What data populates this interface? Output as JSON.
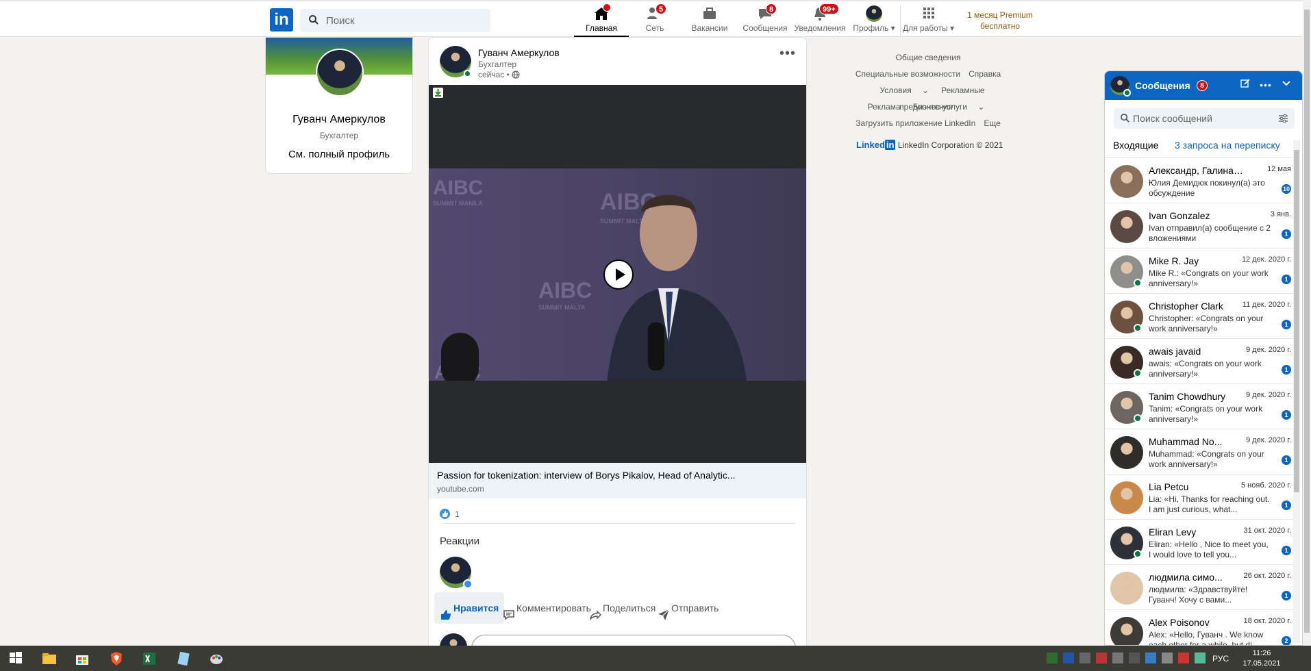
{
  "nav": {
    "search_placeholder": "Поиск",
    "items": [
      {
        "label": "Главная",
        "badge": ""
      },
      {
        "label": "Сеть",
        "badge": "5"
      },
      {
        "label": "Вакансии",
        "badge": ""
      },
      {
        "label": "Сообщения",
        "badge": "8"
      },
      {
        "label": "Уведомления",
        "badge": "99+"
      },
      {
        "label": "Профиль",
        "badge": ""
      },
      {
        "label": "Для работы",
        "badge": ""
      }
    ],
    "premium_line1": "1 месяц Premium",
    "premium_line2": "бесплатно"
  },
  "profile": {
    "name": "Гуванч Амеркулов",
    "title": "Бухгалтер",
    "link": "См. полный профиль"
  },
  "post": {
    "author": "Гуванч Амеркулов",
    "subtitle": "Бухгалтер",
    "time": "сейчас •",
    "link_title": "Passion for tokenization: interview of Borys Pikalov, Head of Analytic...",
    "link_domain": "youtube.com",
    "likes_count": "1",
    "reactions_title": "Реакции",
    "actions": {
      "like": "Нравится",
      "comment": "Комментировать",
      "share": "Поделиться",
      "send": "Отправить"
    },
    "video_watermarks": [
      "AIBC",
      "SUMMIT MANILA",
      "AIBC",
      "SUMMIT MALTA",
      "AIBC",
      "SUMMIT MALTA",
      "AIBC"
    ]
  },
  "footer": {
    "rows": [
      [
        "Общие сведения"
      ],
      [
        "Специальные возможности",
        "Справка"
      ],
      [
        "Условия",
        "Рекламные предпочтения"
      ],
      [
        "Реклама",
        "Бизнес-услуги"
      ],
      [
        "Загрузить приложение LinkedIn",
        "Еще"
      ]
    ],
    "copyright_brand": "Linked",
    "copyright_text": "LinkedIn Corporation © 2021"
  },
  "messaging": {
    "title": "Сообщения",
    "badge": "8",
    "search_placeholder": "Поиск сообщений",
    "tab_inbox": "Входящие",
    "tab_requests": "3 запроса на переписку",
    "conversations": [
      {
        "name": "Александр, Галина, Ге...",
        "date": "12 мая",
        "snippet": "Юлия Демидюк покинул(а) это обсуждение",
        "unread": "10",
        "online": false,
        "avatar_color": "#8a6f5a"
      },
      {
        "name": "Ivan Gonzalez",
        "date": "3 янв.",
        "snippet": "Ivan отправил(а) сообщение с 2 вложениями",
        "unread": "1",
        "online": false,
        "avatar_color": "#5b4a43"
      },
      {
        "name": "Mike R. Jay",
        "date": "12 дек. 2020 г.",
        "snippet": "Mike R.: «Congrats on your work anniversary!»",
        "unread": "1",
        "online": true,
        "avatar_color": "#8e8f8a"
      },
      {
        "name": "Christopher Clark",
        "date": "11 дек. 2020 г.",
        "snippet": "Christopher: «Congrats on your work anniversary!»",
        "unread": "1",
        "online": true,
        "avatar_color": "#6f5140"
      },
      {
        "name": "awais javaid",
        "date": "9 дек. 2020 г.",
        "snippet": "awais: «Congrats on your work anniversary!»",
        "unread": "1",
        "online": true,
        "avatar_color": "#3b2b26"
      },
      {
        "name": "Tanim Chowdhury",
        "date": "9 дек. 2020 г.",
        "snippet": "Tanim: «Congrats on your work anniversary!»",
        "unread": "1",
        "online": true,
        "avatar_color": "#6d6560"
      },
      {
        "name": "Muhammad No...",
        "date": "9 дек. 2020 г.",
        "snippet": "Muhammad: «Congrats on your work anniversary!»",
        "unread": "1",
        "online": false,
        "avatar_color": "#2f2d2a"
      },
      {
        "name": "Lia Petcu",
        "date": "5 нояб. 2020 г.",
        "snippet": "Lia: «Hi, Thanks for reaching out. I am just curious, what...",
        "unread": "1",
        "online": false,
        "avatar_color": "#c9894a"
      },
      {
        "name": "Eliran Levy",
        "date": "31 окт. 2020 г.",
        "snippet": "Eliran: «Hello , Nice to meet you, I would love to tell you...",
        "unread": "1",
        "online": true,
        "avatar_color": "#2e3238"
      },
      {
        "name": "людмила симо...",
        "date": "26 окт. 2020 г.",
        "snippet": "людмила: «Здравствуйте! Гуванч! Хочу с вами...",
        "unread": "1",
        "online": false,
        "avatar_color": "#e0c5a8"
      },
      {
        "name": "Alex Poisonov",
        "date": "18 окт. 2020 г.",
        "snippet": "Alex: «Hello, Гуванч . We know each other for a while, but di...",
        "unread": "2",
        "online": false,
        "avatar_color": "#3d3a38"
      }
    ]
  },
  "taskbar": {
    "lang": "РУС",
    "time": "11:26",
    "date": "17.05.2021"
  },
  "colors": {
    "brand": "#0a66c2",
    "badge": "#cc1016",
    "online": "#057642",
    "page_bg": "#f3f2ef"
  }
}
